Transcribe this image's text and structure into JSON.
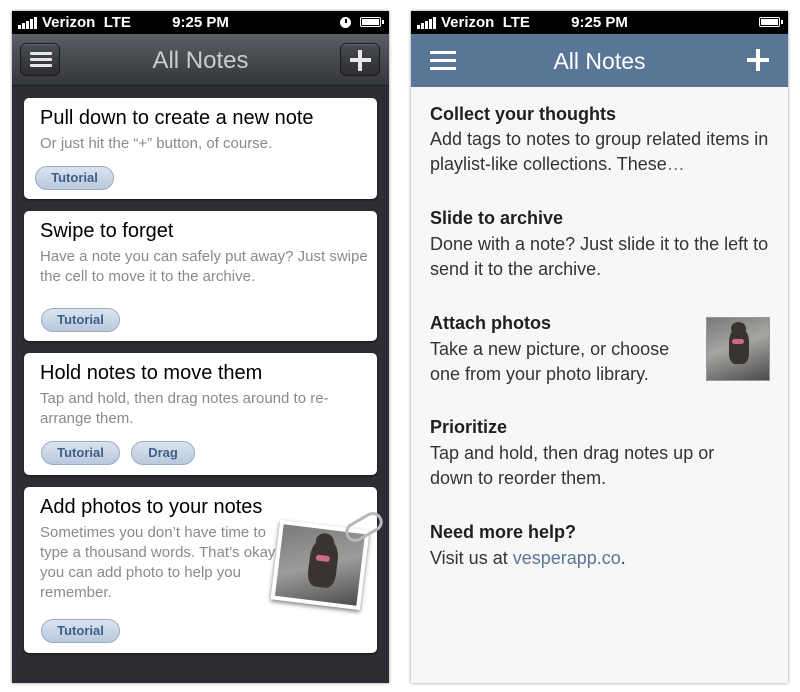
{
  "left": {
    "status": {
      "carrier": "Verizon",
      "network": "LTE",
      "time": "9:25 PM"
    },
    "title": "All Notes",
    "notes": [
      {
        "title": "Pull down to create a new note",
        "body": "Or just hit the “+” button, of course.",
        "tags": [
          "Tutorial"
        ]
      },
      {
        "title": "Swipe to forget",
        "body": "Have a note you can safely put away? Just swipe the cell to move it to the archive.",
        "tags": [
          "Tutorial"
        ]
      },
      {
        "title": "Hold notes to move them",
        "body": "Tap and hold, then drag notes around to re-arrange them.",
        "tags": [
          "Tutorial",
          "Drag"
        ]
      },
      {
        "title": "Add photos to your notes",
        "body": "Sometimes you don’t have time to type a thousand words. That’s okay, you can add photo to help you remember.",
        "tags": [
          "Tutorial"
        ]
      }
    ]
  },
  "right": {
    "status": {
      "carrier": "Verizon",
      "network": "LTE",
      "time": "9:25 PM"
    },
    "title": "All Notes",
    "sections": [
      {
        "title": "Collect your thoughts",
        "body": "Add tags to notes to group related items in playlist-like collections. These",
        "more": "…"
      },
      {
        "title": "Slide to archive",
        "body": "Done with a note? Just slide it to the left to send it to the archive."
      },
      {
        "title": "Attach photos",
        "body": "Take a new picture, or choose one from your photo library."
      },
      {
        "title": "Prioritize",
        "body": "Tap and hold, then drag notes up or down to reorder them."
      },
      {
        "title": "Need more help?",
        "body_prefix": "Visit us at ",
        "link": "vesperapp.co",
        "body_suffix": "."
      }
    ]
  }
}
